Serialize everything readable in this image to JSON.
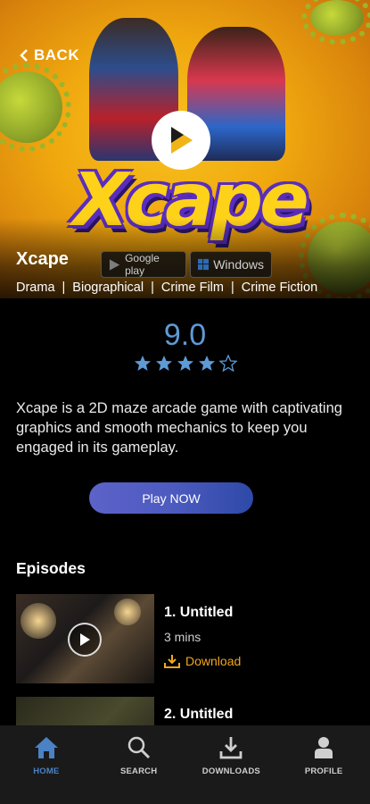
{
  "hero": {
    "back_label": "BACK",
    "logo_text": "Xcape",
    "title": "Xcape",
    "stores": [
      {
        "name": "Google play",
        "icon": "google-play-icon"
      },
      {
        "name": "Windows",
        "icon": "windows-icon"
      }
    ],
    "genres": [
      "Drama",
      "Biographical",
      "Crime Film",
      "Crime Fiction"
    ],
    "genre_separator": "|"
  },
  "rating": {
    "score": "9.0",
    "stars_filled": 4,
    "stars_total": 5,
    "star_color": "#5d9bd6"
  },
  "description": "Xcape is a 2D maze arcade game with captivating graphics and smooth mechanics to keep you engaged in its gameplay.",
  "play_button": {
    "label": "Play NOW"
  },
  "episodes": {
    "title": "Episodes",
    "items": [
      {
        "name": "1. Untitled",
        "duration": "3 mins",
        "download_label": "Download"
      },
      {
        "name": "2. Untitled"
      }
    ]
  },
  "nav": {
    "items": [
      {
        "label": "HOME",
        "icon": "home-icon",
        "active": true
      },
      {
        "label": "SEARCH",
        "icon": "search-icon",
        "active": false
      },
      {
        "label": "DOWNLOADS",
        "icon": "download-icon",
        "active": false
      },
      {
        "label": "PROFILE",
        "icon": "profile-icon",
        "active": false
      }
    ]
  },
  "colors": {
    "accent_blue": "#4b82c4",
    "download_orange": "#f2a71b",
    "logo_yellow": "#ffd21a"
  }
}
